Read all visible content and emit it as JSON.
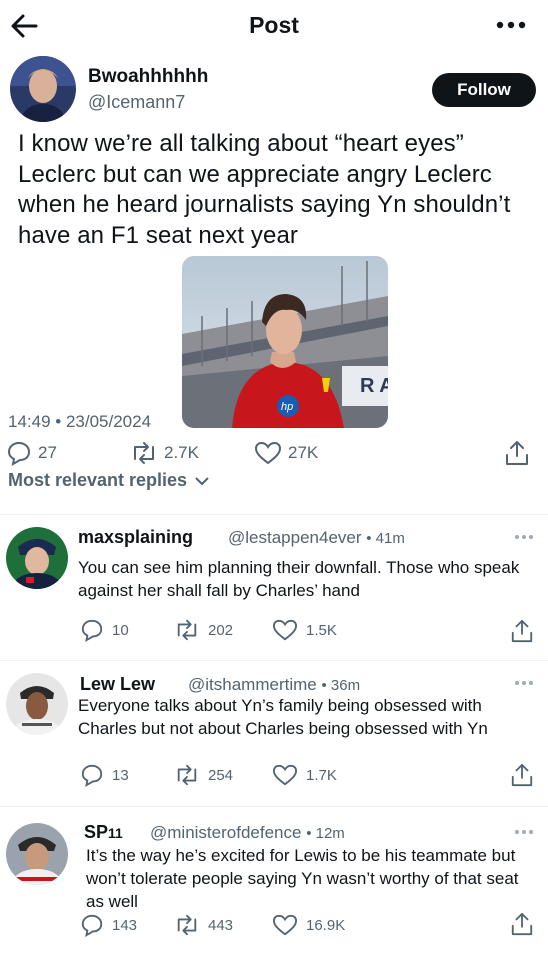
{
  "header": {
    "title": "Post"
  },
  "post": {
    "author_name": "Bwoahhhhhh",
    "author_handle": "@Icemann7",
    "follow_label": "Follow",
    "text": "I know we’re all talking about “heart eyes” Leclerc but can we appreciate angry Leclerc when he heard journalists saying Yn shouldn’t have an F1 seat next year",
    "timestamp": "14:49 • 23/05/2024",
    "replies": "27",
    "reposts": "2.7K",
    "likes": "27K",
    "media_banner_text": "R A"
  },
  "most_relevant_label": "Most relevant replies",
  "replies": [
    {
      "name": "maxsplaining",
      "handle": "@lestappen4ever",
      "time": "• 41m",
      "text": "You can see him planning their downfall. Those who speak against her shall fall by Charles’ hand",
      "replies": "10",
      "reposts": "202",
      "likes": "1.5K"
    },
    {
      "name": "Lew Lew",
      "handle": "@itshammertime",
      "time": "• 36m",
      "text": "Everyone talks about Yn’s family being obsessed with Charles but not about Charles being obsessed with Yn",
      "replies": "13",
      "reposts": "254",
      "likes": "1.7K"
    },
    {
      "name": "SP",
      "name_suffix": "11",
      "handle": "@ministerofdefence",
      "time": "• 12m",
      "text": "It’s the way he’s excited for Lewis to be his teammate but  won’t tolerate people saying Yn wasn’t worthy of that seat as well",
      "replies": "143",
      "reposts": "443",
      "likes": "16.9K"
    }
  ],
  "colors": {
    "text": "#0f1419",
    "secondary": "#536471",
    "follow_bg": "#0f1419",
    "divider": "#eff3f4",
    "ferrari_red": "#c8161d"
  }
}
